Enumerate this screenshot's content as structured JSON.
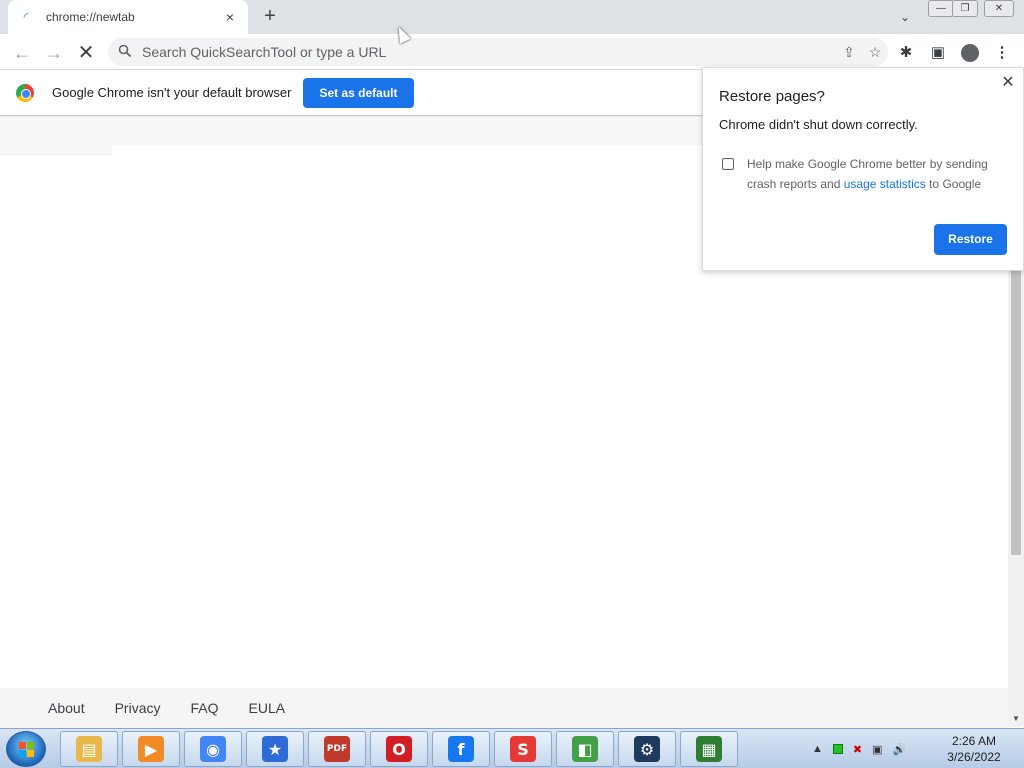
{
  "tab": {
    "title": "chrome://newtab",
    "close_icon": "×"
  },
  "tabstrip": {
    "new_tab_icon": "+",
    "tab_search_icon": "⌄"
  },
  "window": {
    "minimize": "—",
    "maximize": "❐",
    "close": "✕"
  },
  "toolbar": {
    "back_icon": "←",
    "forward_icon": "→",
    "stop_icon": "✕",
    "omnibox_placeholder": "Search QuickSearchTool or type a URL",
    "share_icon": "⇪",
    "star_icon": "☆",
    "extensions_icon": "✱",
    "side_panel_icon": "▣",
    "menu_icon": "⋮"
  },
  "infobar": {
    "message": "Google Chrome isn't your default browser",
    "button_label": "Set as default"
  },
  "footer": {
    "links": [
      "About",
      "Privacy",
      "FAQ",
      "EULA"
    ]
  },
  "dialog": {
    "title": "Restore pages?",
    "subtitle": "Chrome didn't shut down correctly.",
    "help_text_before": "Help make Google Chrome better by sending crash reports and ",
    "help_link": "usage statistics",
    "help_text_after": " to Google",
    "restore_label": "Restore",
    "close_icon": "✕"
  },
  "taskbar": {
    "items": [
      {
        "name": "file-explorer",
        "color": "#e8b84a",
        "glyph": "▤"
      },
      {
        "name": "media-player",
        "color": "#f08a24",
        "glyph": "▶"
      },
      {
        "name": "chrome",
        "color": "#4285f4",
        "glyph": "◉"
      },
      {
        "name": "favorites-star",
        "color": "#2f6bd6",
        "glyph": "★"
      },
      {
        "name": "pdf-reader",
        "color": "#c0392b",
        "glyph": "PDF"
      },
      {
        "name": "opera",
        "color": "#d21f26",
        "glyph": "O"
      },
      {
        "name": "facebook",
        "color": "#1877f2",
        "glyph": "f"
      },
      {
        "name": "s-app",
        "color": "#e53935",
        "glyph": "S"
      },
      {
        "name": "stacks-app",
        "color": "#43a047",
        "glyph": "◧"
      },
      {
        "name": "gear-app",
        "color": "#1e3a5f",
        "glyph": "⚙"
      },
      {
        "name": "monitor-app",
        "color": "#2e7d32",
        "glyph": "▦"
      }
    ],
    "tray": {
      "show_hidden": "▲",
      "network": "▣",
      "speaker": "🔊"
    },
    "clock_time": "2:26 AM",
    "clock_date": "3/26/2022"
  }
}
